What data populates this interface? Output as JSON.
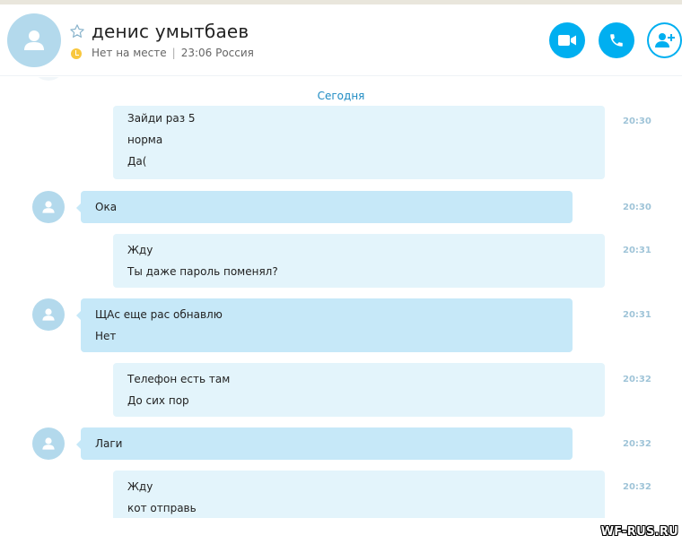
{
  "contact": {
    "name": "денис умытбаев",
    "status": "Нет на месте",
    "local_time": "23:06 Россия"
  },
  "colors": {
    "accent": "#00aff0",
    "incoming_bubble": "#c6e8f8",
    "outgoing_bubble": "#e3f4fb",
    "date_separator": "#1e8bc3",
    "away_status": "#f8c73e"
  },
  "icons": {
    "avatar": "person-icon",
    "favorite": "star-icon",
    "status": "away-clock-icon",
    "video_call": "video-camera-icon",
    "audio_call": "phone-icon",
    "add_people": "add-person-icon"
  },
  "conversation": {
    "date_separator": "Сегодня",
    "messages": [
      {
        "direction": "out",
        "lines": [
          "Зайди раз 5",
          "норма",
          "Да("
        ],
        "time": "20:30"
      },
      {
        "direction": "in",
        "lines": [
          "Ока"
        ],
        "time": "20:30"
      },
      {
        "direction": "out",
        "lines": [
          "Жду",
          "Ты даже пароль поменял?"
        ],
        "time": "20:31"
      },
      {
        "direction": "in",
        "lines": [
          "ЩАс еще рас обнавлю",
          "Нет"
        ],
        "time": "20:31"
      },
      {
        "direction": "out",
        "lines": [
          "Телефон есть там",
          "До сих пор"
        ],
        "time": "20:32"
      },
      {
        "direction": "in",
        "lines": [
          "Лаги"
        ],
        "time": "20:32"
      },
      {
        "direction": "out",
        "lines": [
          "Жду",
          "кот отправь"
        ],
        "time": "20:32"
      }
    ]
  },
  "watermark": "WF-RUS.RU"
}
